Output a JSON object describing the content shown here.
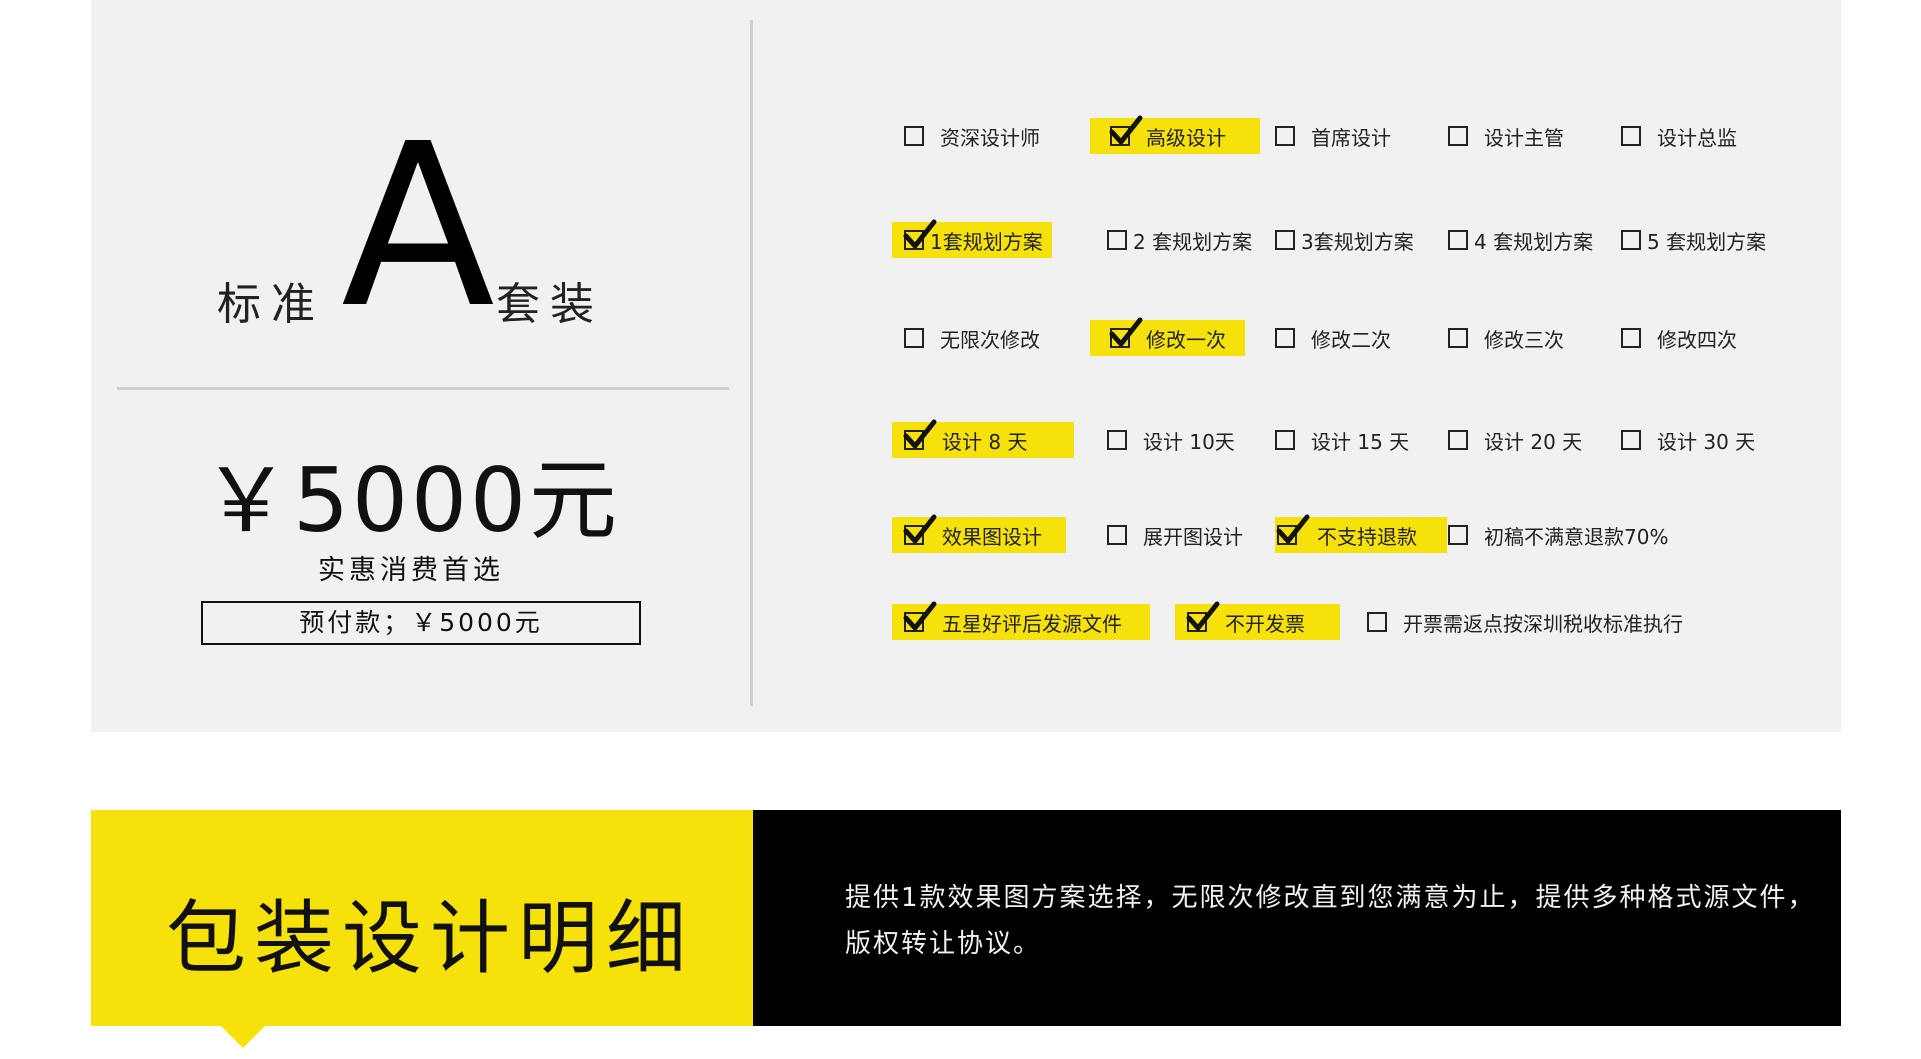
{
  "package": {
    "prefix": "标准",
    "letter": "A",
    "suffix": "套装",
    "price": "￥5000元",
    "subtitle": "实惠消费首选",
    "deposit": "预付款；￥5000元"
  },
  "options": {
    "rows": [
      [
        {
          "label": "资深设计师",
          "checked": false
        },
        {
          "label": "高级设计",
          "checked": true
        },
        {
          "label": "首席设计",
          "checked": false
        },
        {
          "label": "设计主管",
          "checked": false
        },
        {
          "label": "设计总监",
          "checked": false
        }
      ],
      [
        {
          "label": "1套规划方案",
          "checked": true
        },
        {
          "label": "2 套规划方案",
          "checked": false
        },
        {
          "label": "3套规划方案",
          "checked": false
        },
        {
          "label": "4 套规划方案",
          "checked": false
        },
        {
          "label": "5 套规划方案",
          "checked": false
        }
      ],
      [
        {
          "label": "无限次修改",
          "checked": false
        },
        {
          "label": "修改一次",
          "checked": true
        },
        {
          "label": "修改二次",
          "checked": false
        },
        {
          "label": "修改三次",
          "checked": false
        },
        {
          "label": "修改四次",
          "checked": false
        }
      ],
      [
        {
          "label": "设计 8 天",
          "checked": true
        },
        {
          "label": "设计 10天",
          "checked": false
        },
        {
          "label": "设计 15 天",
          "checked": false
        },
        {
          "label": "设计 20 天",
          "checked": false
        },
        {
          "label": "设计 30 天",
          "checked": false
        }
      ],
      [
        {
          "label": "效果图设计",
          "checked": true
        },
        {
          "label": "展开图设计",
          "checked": false
        },
        {
          "label": "不支持退款",
          "checked": true
        },
        {
          "label": "初稿不满意退款70%",
          "checked": false
        }
      ],
      [
        {
          "label": "五星好评后发源文件",
          "checked": true
        },
        {
          "label": "不开发票",
          "checked": true
        },
        {
          "label": "开票需返点按深圳税收标准执行",
          "checked": false
        }
      ]
    ]
  },
  "banner": {
    "title": "包装设计明细",
    "description": "提供1款效果图方案选择，无限次修改直到您满意为止，提供多种格式源文件，版权转让协议。"
  },
  "colors": {
    "accent_yellow": "#f7e10a",
    "card_bg": "#f1f1f1",
    "banner_black": "#000000"
  }
}
